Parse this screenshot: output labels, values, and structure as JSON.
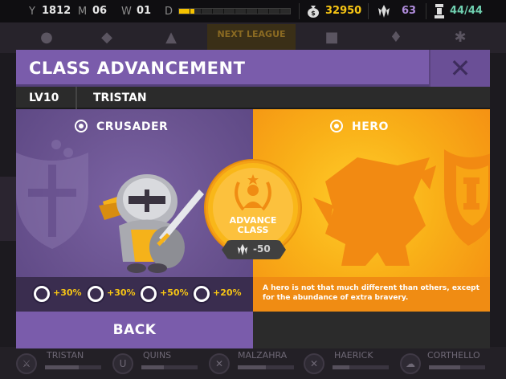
{
  "status": {
    "year_label": "Y",
    "year": "1812",
    "month_label": "M",
    "month": "06",
    "week_label": "W",
    "week": "01",
    "day_label": "D",
    "day_progress": 0.14,
    "gold": "32950",
    "gems": "63",
    "roster": "44/44",
    "colors": {
      "gold": "#f7c514",
      "gems": "#b08cdc",
      "roster": "#6fd0b0"
    }
  },
  "background": {
    "next_league": "NEXT LEAGUE",
    "heroes": [
      {
        "name": "TRISTAN",
        "bar": 0.6
      },
      {
        "name": "QUINS",
        "bar": 0.4
      },
      {
        "name": "MALZAHRA",
        "bar": 0.5
      },
      {
        "name": "HAERICK",
        "bar": 0.3
      },
      {
        "name": "CORTHELLO",
        "bar": 0.55
      }
    ]
  },
  "dialog": {
    "title": "CLASS ADVANCEMENT",
    "close_icon": "close-icon",
    "level": "LV10",
    "hero_name": "TRISTAN",
    "current_class": {
      "name": "CRUSADER",
      "color": "#6a5390",
      "stats": [
        {
          "icon": "defense-icon",
          "value": "+30%"
        },
        {
          "icon": "attack-icon",
          "value": "+30%"
        },
        {
          "icon": "speed-icon",
          "value": "+50%"
        },
        {
          "icon": "health-icon",
          "value": "+20%"
        }
      ]
    },
    "next_class": {
      "name": "HERO",
      "color": "#f8a515",
      "description": "A hero is not that much different than others, except for the abundance of extra bravery."
    },
    "advance": {
      "line1": "ADVANCE",
      "line2": "CLASS",
      "cost": "-50"
    },
    "back_label": "BACK"
  }
}
